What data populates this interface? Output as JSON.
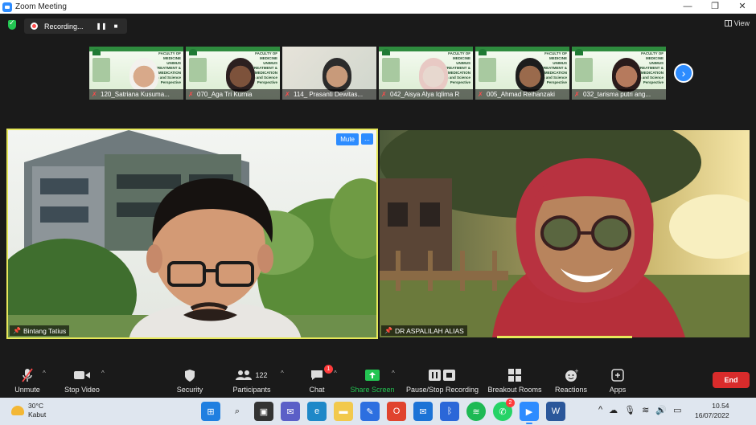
{
  "window": {
    "title": "Zoom Meeting"
  },
  "topbar": {
    "recording_label": "Recording...",
    "view_label": "View"
  },
  "thumbnails": [
    {
      "name": "120_Satriana Kusuma...",
      "skin": "#d8a98a",
      "hijab": "#f3f1ed"
    },
    {
      "name": "070_Aga Tri Kurnia",
      "skin": "#7d523b",
      "hijab": "#2c2020"
    },
    {
      "name": "114_ Prasanti Dewitas...",
      "skin": "#c89a7a",
      "hijab": "#2b2b2b"
    },
    {
      "name": "042_Aisya Alya Iqlima R",
      "skin": "#e7d8cf",
      "hijab": "#e8c9c4"
    },
    {
      "name": "005_Ahmad Reihanzaki",
      "skin": "#9a6a4c",
      "hijab": "#1d1d1d"
    },
    {
      "name": "032_tarisma putri ang...",
      "skin": "#b67a5d",
      "hijab": "#2a1b1b"
    }
  ],
  "slide": {
    "faculty": "FACULTY OF MEDICINE",
    "university": "UNIMUS",
    "title_line": "TREATMENT & MEDICATION",
    "subtitle_line": "in Islam and Science",
    "tag": "Perspective"
  },
  "main": {
    "left": {
      "name": "Bintang Tatius",
      "mute_label": "Mute",
      "more_label": "..."
    },
    "right": {
      "name": "DR ASPALILAH ALIAS"
    }
  },
  "toolbar": {
    "unmute": "Unmute",
    "stop_video": "Stop Video",
    "security": "Security",
    "participants": "Participants",
    "participant_count": "122",
    "chat": "Chat",
    "chat_badge": "1",
    "share_screen": "Share Screen",
    "recording": "Pause/Stop Recording",
    "breakout": "Breakout Rooms",
    "reactions": "Reactions",
    "apps": "Apps",
    "end": "End"
  },
  "taskbar": {
    "weather_temp": "30°C",
    "weather_desc": "Kabut",
    "time": "10.54",
    "date": "16/07/2022",
    "whatsapp_badge": "2"
  },
  "colors": {
    "zoom_blue": "#2D8CFF",
    "speaker_highlight": "#e6e85a",
    "end_red": "#d92b2b",
    "share_green": "#23c552"
  }
}
